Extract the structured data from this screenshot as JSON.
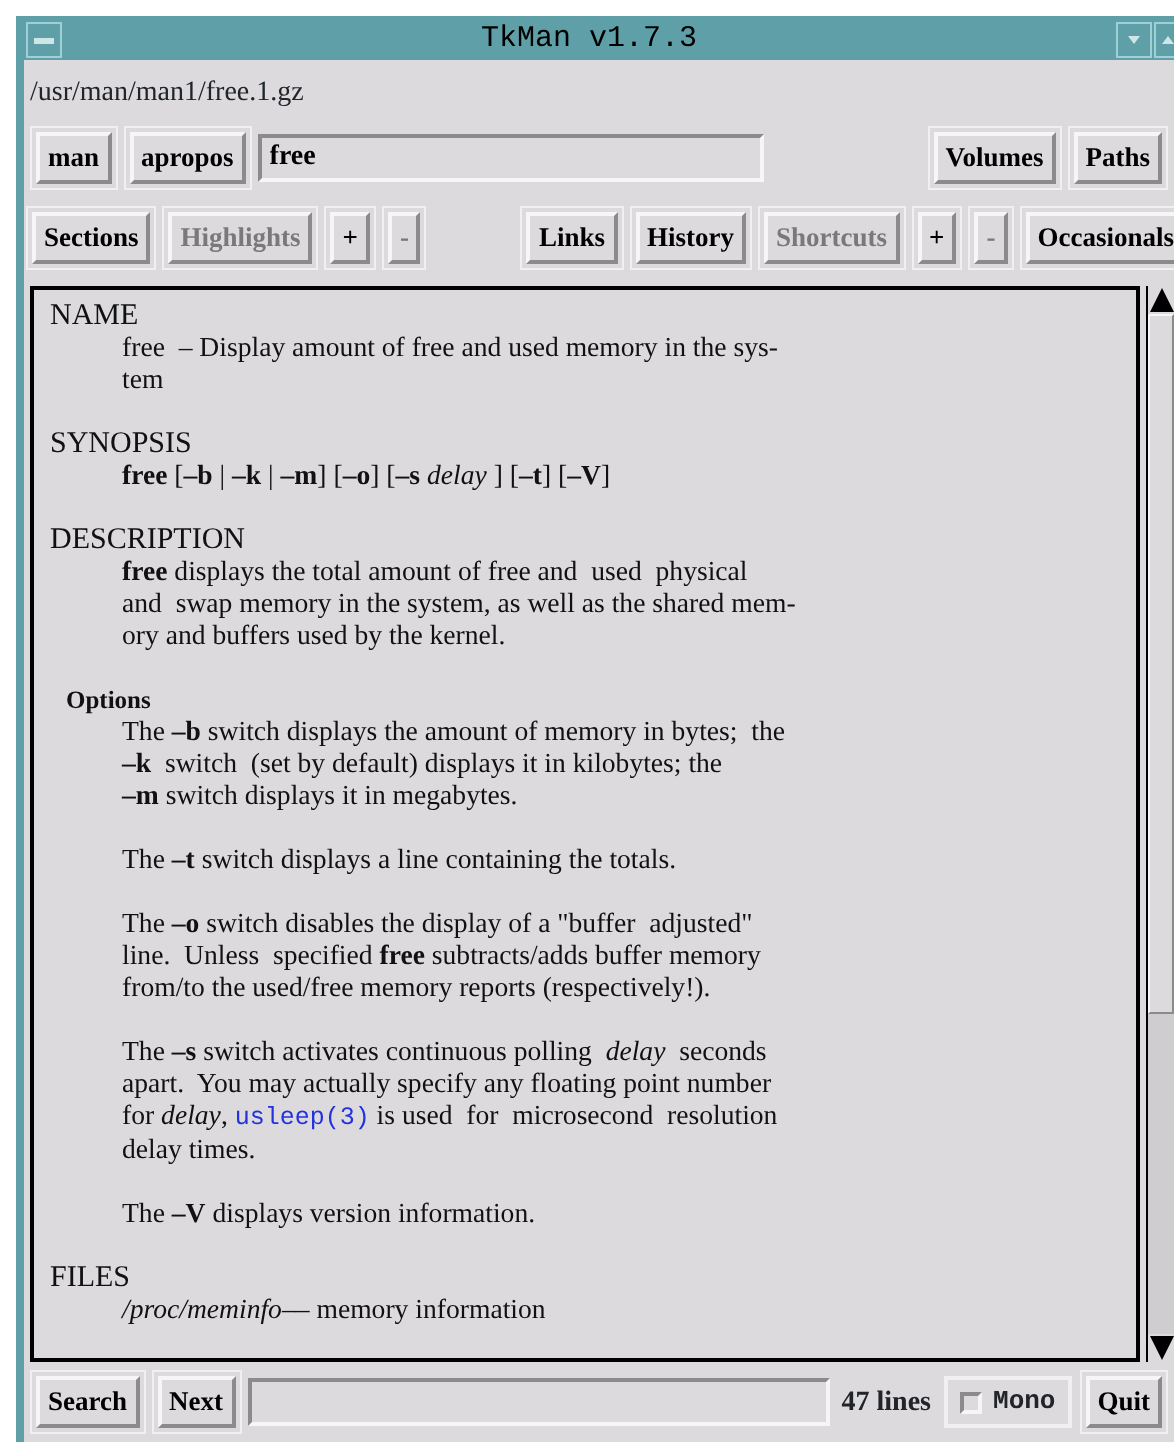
{
  "window": {
    "title": "TkMan v1.7.3"
  },
  "path": "/usr/man/man1/free.1.gz",
  "search_row": {
    "buttons": [
      {
        "label": "man",
        "disabled": false
      },
      {
        "label": "apropos",
        "disabled": false
      }
    ],
    "query": "free",
    "right_buttons": [
      {
        "label": "Volumes",
        "disabled": false
      },
      {
        "label": "Paths",
        "disabled": false
      }
    ]
  },
  "toolbar": {
    "groups": [
      [
        {
          "label": "Sections",
          "disabled": false
        },
        {
          "label": "Highlights",
          "disabled": true
        },
        {
          "label": "+",
          "disabled": false
        },
        {
          "label": "-",
          "disabled": true
        }
      ],
      [
        {
          "label": "Links",
          "disabled": false
        },
        {
          "label": "History",
          "disabled": false
        },
        {
          "label": "Shortcuts",
          "disabled": true
        },
        {
          "label": "+",
          "disabled": false
        },
        {
          "label": "-",
          "disabled": true
        }
      ],
      [
        {
          "label": "Occasionals",
          "disabled": false
        }
      ]
    ]
  },
  "page": {
    "sections": [
      {
        "kind": "heading",
        "text": "NAME",
        "paragraphs": [
          [
            "free  – Display amount of free and used memory in the sys-",
            "tem"
          ]
        ]
      },
      {
        "kind": "heading",
        "text": "SYNOPSIS",
        "paragraphs": [
          [
            "**free** [**–b** | **–k** | **–m**] [**–o**] [**–s** *delay* ] [**–t**] [**–V**]"
          ]
        ]
      },
      {
        "kind": "heading",
        "text": "DESCRIPTION",
        "paragraphs": [
          [
            "**free** displays the total amount of free and  used  physical",
            "and  swap memory in the system, as well as the shared mem-",
            "ory and buffers used by the kernel."
          ]
        ]
      },
      {
        "kind": "subheading",
        "text": "Options",
        "paragraphs": [
          [
            "The **–b** switch displays the amount of memory in bytes;  the",
            "**–k**  switch  (set by default) displays it in kilobytes; the",
            "**–m** switch displays it in megabytes."
          ],
          [
            "The **–t** switch displays a line containing the totals."
          ],
          [
            "The **–o** switch disables the display of a \"buffer  adjusted\"",
            "line.  Unless  specified **free** subtracts/adds buffer memory",
            "from/to the used/free memory reports (respectively!)."
          ],
          [
            "The **–s** switch activates continuous polling  *delay*  seconds",
            "apart.  You may actually specify any floating point number",
            {
              "before": "for *delay*, ",
              "link": "usleep(3)",
              "after": " is used  for  microsecond  resolution"
            },
            "delay times."
          ],
          [
            "The **–V** displays version information."
          ]
        ]
      },
      {
        "kind": "heading",
        "text": "FILES",
        "paragraphs": [
          [
            "*/proc/meminfo*–– memory information"
          ]
        ]
      }
    ]
  },
  "bottom": {
    "search_button": "Search",
    "next_button": "Next",
    "line_count": "47 lines",
    "mono": {
      "label": "Mono",
      "checked": false
    },
    "quit_button": "Quit"
  }
}
